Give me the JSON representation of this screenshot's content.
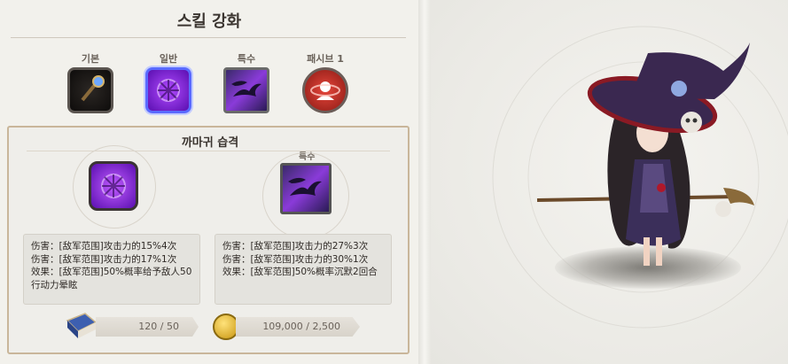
{
  "header": {
    "title": "스킬 강화"
  },
  "tabs": [
    {
      "label": "기본",
      "icon": "staff-icon"
    },
    {
      "label": "일반",
      "icon": "purple-rune-icon",
      "selected": true
    },
    {
      "label": "특수",
      "icon": "crow-icon"
    },
    {
      "label": "패시브 1",
      "icon": "red-aura-icon"
    }
  ],
  "skill": {
    "name": "까마귀 습격",
    "target_badge": "특수",
    "current_effects": "伤害：[敌军范围]攻击力的15%4次\n伤害：[敌军范围]攻击力的17%1次\n效果：[敌军范围]50%概率给予敌人50行动力晕眩",
    "next_effects": "伤害：[敌军范围]攻击力的27%3次\n伤害：[敌军范围]攻击力的30%1次\n效果：[敌军范围]50%概率沉默2回合"
  },
  "resources": {
    "book_count": "120 / 50",
    "gold_count": "109,000 / 2,500"
  },
  "colors": {
    "accent_gold": "#c9b69a",
    "selected_blue": "#5a6bff",
    "skill_purple": "#7a1fd6"
  }
}
